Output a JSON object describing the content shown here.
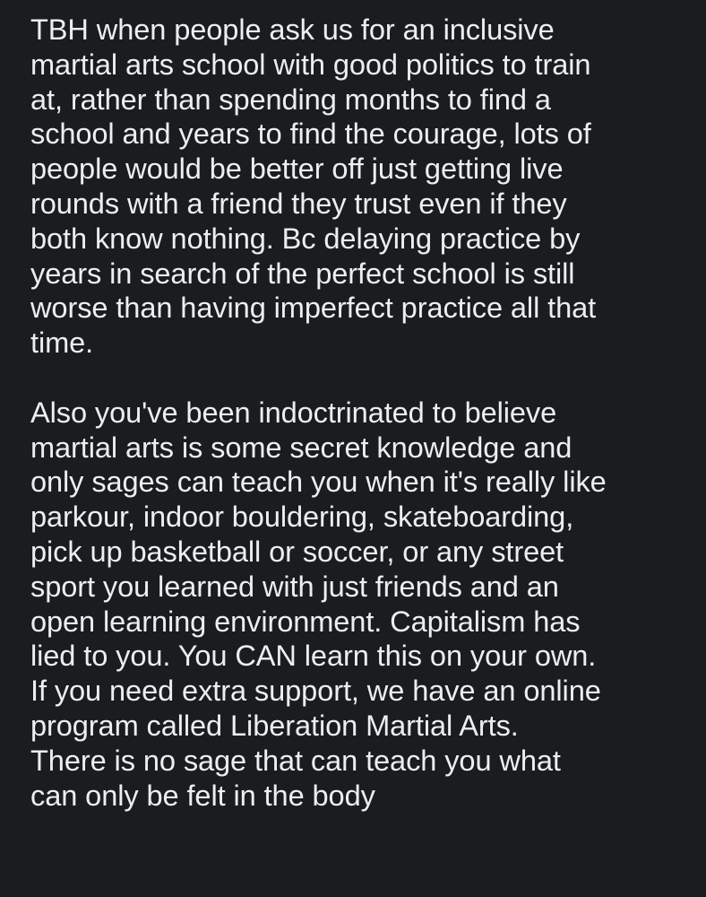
{
  "post": {
    "paragraphs": [
      {
        "lines": [
          "TBH when people ask us for an inclusive",
          "martial arts school with good politics to train",
          "at, rather than spending months to find a",
          "school and years to find the courage, lots of",
          "people would be better off just getting live",
          "rounds with a friend they trust even if they",
          "both know nothing. Bc delaying practice by",
          "years in search of the perfect school is still",
          "worse than having imperfect practice all that",
          "time."
        ]
      },
      {
        "lines": [
          "Also you've been indoctrinated to believe",
          "martial arts is some secret knowledge and",
          "only sages can teach you when it's really like",
          "parkour, indoor bouldering, skateboarding,",
          "pick up basketball or soccer, or any street",
          "sport you learned with just friends and an",
          "open learning environment. Capitalism has",
          "lied to you. You CAN learn this on your own.",
          "If you need extra support, we have an online",
          "program called Liberation Martial Arts.",
          "There is no sage that can teach you what",
          "can only be felt in the body"
        ]
      }
    ]
  },
  "colors": {
    "background": "#1b1c1e",
    "text": "#eceef0"
  }
}
